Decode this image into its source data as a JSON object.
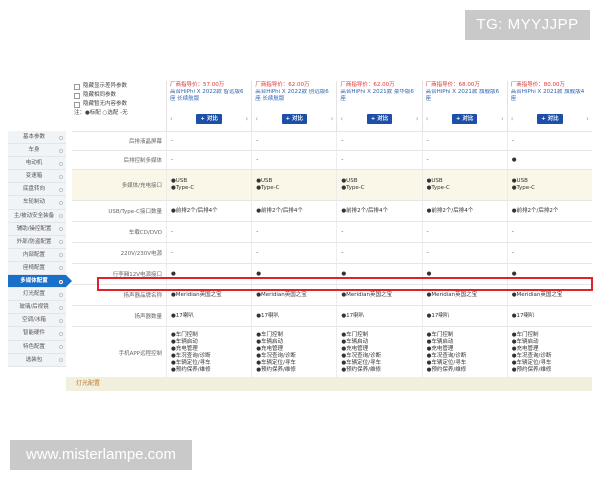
{
  "watermarks": {
    "top": "TG: MYYJJPP",
    "bottom": "www.misterlampe.com"
  },
  "options": [
    "隐藏显示差异参数",
    "隐藏相同参数",
    "隐藏暂无内容参数"
  ],
  "legend": "注：●标配 ○选配 -无",
  "cars": [
    {
      "price_label": "厂商指导价：",
      "price": "57.00万",
      "name": "高合HiPhi X 2022款 智远版6座 长续航版",
      "compare": "+ 对比"
    },
    {
      "price_label": "厂商指导价：",
      "price": "62.00万",
      "name": "高合HiPhi X 2022款 创远版6座 长续航版",
      "compare": "+ 对比"
    },
    {
      "price_label": "厂商指导价：",
      "price": "62.00万",
      "name": "高合HiPhi X 2021款 豪华版6座",
      "compare": "+ 对比"
    },
    {
      "price_label": "厂商指导价：",
      "price": "68.00万",
      "name": "高合HiPhi X 2021款 旗舰版6座",
      "compare": "+ 对比"
    },
    {
      "price_label": "厂商指导价：",
      "price": "80.00万",
      "name": "高合HiPhi X 2021款 旗舰版4座",
      "compare": "+ 对比"
    }
  ],
  "nav_items": [
    "基本参数",
    "车身",
    "电动机",
    "变速箱",
    "底盘转向",
    "车轮制动",
    "主/被动安全装备",
    "辅助/操控配置",
    "外部/防盗配置",
    "内部配置",
    "座椅配置",
    "多媒体配置",
    "灯光配置",
    "玻璃/后视镜",
    "空调/冰箱",
    "智能硬件",
    "特色配置",
    "选装包"
  ],
  "active_nav": "多媒体配置",
  "rows": [
    {
      "label": "后排液晶屏幕",
      "values": [
        [
          "-"
        ],
        [
          "-"
        ],
        [
          "-"
        ],
        [
          "-"
        ],
        [
          "-"
        ]
      ]
    },
    {
      "label": "后排控制多媒体",
      "values": [
        [
          "-"
        ],
        [
          "-"
        ],
        [
          "-"
        ],
        [
          "-"
        ],
        [
          "●"
        ]
      ]
    },
    {
      "label": "多媒体/充电接口",
      "shaded": true,
      "values": [
        [
          "●USB",
          "●Type-C"
        ],
        [
          "●USB",
          "●Type-C"
        ],
        [
          "●USB",
          "●Type-C"
        ],
        [
          "●USB",
          "●Type-C"
        ],
        [
          "●USB",
          "●Type-C"
        ]
      ]
    },
    {
      "label": "USB/Type-C接口数量",
      "values": [
        [
          "●前排2个/后排4个"
        ],
        [
          "●前排2个/后排4个"
        ],
        [
          "●前排2个/后排4个"
        ],
        [
          "●前排2个/后排4个"
        ],
        [
          "●前排2个/后排2个"
        ]
      ]
    },
    {
      "label": "车载CD/DVD",
      "values": [
        [
          "-"
        ],
        [
          "-"
        ],
        [
          "-"
        ],
        [
          "-"
        ],
        [
          "-"
        ]
      ]
    },
    {
      "label": "220V/230V电源",
      "values": [
        [
          "-"
        ],
        [
          "-"
        ],
        [
          "-"
        ],
        [
          "-"
        ],
        [
          "-"
        ]
      ]
    },
    {
      "label": "行李厢12V电源接口",
      "values": [
        [
          "●"
        ],
        [
          "●"
        ],
        [
          "●"
        ],
        [
          "●"
        ],
        [
          "●"
        ]
      ]
    },
    {
      "label": "扬声器品牌名称",
      "values": [
        [
          "●Meridian英国之宝"
        ],
        [
          "●Meridian英国之宝"
        ],
        [
          "●Meridian英国之宝"
        ],
        [
          "●Meridian英国之宝"
        ],
        [
          "●Meridian英国之宝"
        ]
      ]
    },
    {
      "label": "扬声器数量",
      "values": [
        [
          "●17喇叭"
        ],
        [
          "●17喇叭"
        ],
        [
          "●17喇叭"
        ],
        [
          "●17喇叭"
        ],
        [
          "●17喇叭"
        ]
      ]
    },
    {
      "label": "手机APP远程控制",
      "values": [
        [
          "●车门控制",
          "●车辆启动",
          "●充电管理",
          "●车况查询/诊断",
          "●车辆定位/寻车",
          "●预约保养/维修"
        ],
        [
          "●车门控制",
          "●车辆启动",
          "●充电管理",
          "●车况查询/诊断",
          "●车辆定位/寻车",
          "●预约保养/维修"
        ],
        [
          "●车门控制",
          "●车辆启动",
          "●充电管理",
          "●车况查询/诊断",
          "●车辆定位/寻车",
          "●预约保养/维修"
        ],
        [
          "●车门控制",
          "●车辆启动",
          "●充电管理",
          "●车况查询/诊断",
          "●车辆定位/寻车",
          "●预约保养/维修"
        ],
        [
          "●车门控制",
          "●车辆启动",
          "●充电管理",
          "●车况查询/诊断",
          "●车辆定位/寻车",
          "●预约保养/维修"
        ]
      ]
    }
  ],
  "next_section": "灯光配置",
  "colors": {
    "highlight": "#e1222a",
    "nav_active": "#1a6fc9",
    "compare_button": "#1d4fa8",
    "price": "#dd3333"
  }
}
